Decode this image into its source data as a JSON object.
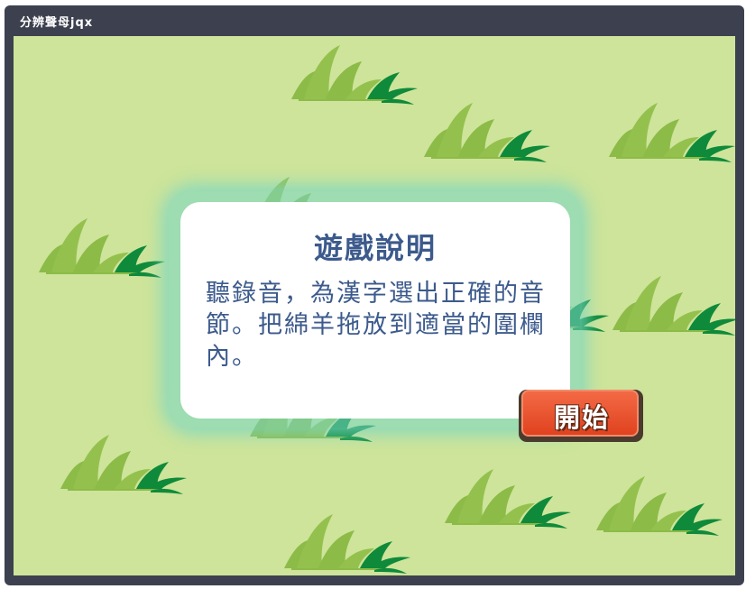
{
  "window": {
    "title": "分辨聲母jqx"
  },
  "instructions": {
    "title": "遊戲說明",
    "body": "聽錄音，為漢字選出正確的音節。把綿羊拖放到適當的圍欄內。"
  },
  "start_button": {
    "label": "開始"
  },
  "colors": {
    "window_frame": "#3d414f",
    "field": "#cde49a",
    "grass_light": "#8cbb48",
    "grass_dark": "#0f8a3a",
    "panel_text": "#3c5a8c",
    "panel_glow": "#78d6c4",
    "start_button": "#e0421f"
  },
  "icons": {
    "grass_tuft": "grass-tuft-icon"
  }
}
